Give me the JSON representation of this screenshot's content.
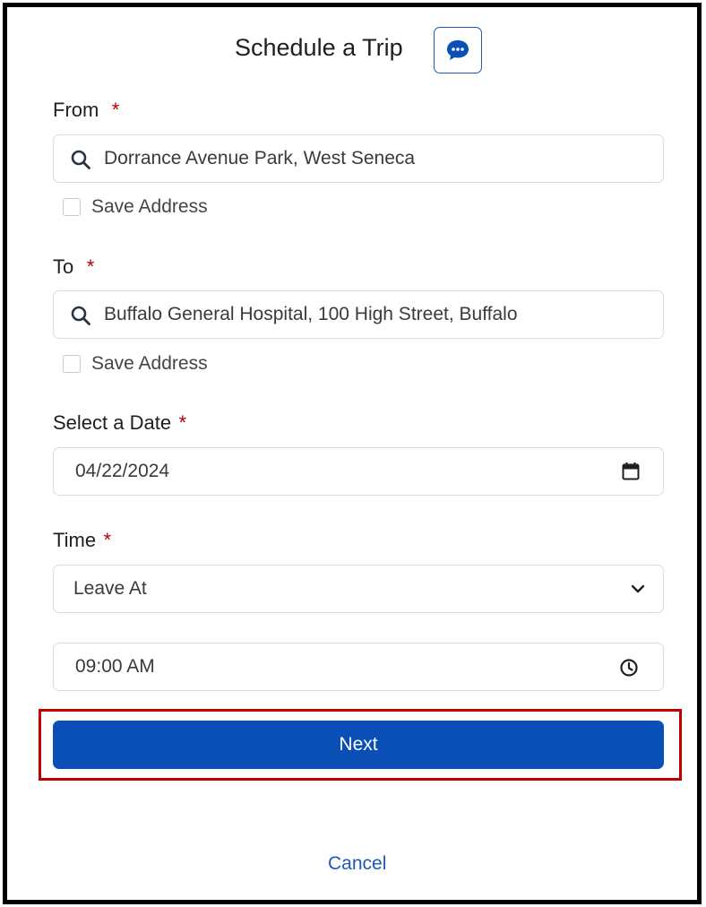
{
  "header": {
    "title": "Schedule a Trip",
    "chat_icon": "chat-bubble-icon"
  },
  "from": {
    "label": "From",
    "required_mark": "*",
    "value": "Dorrance Avenue Park, West Seneca",
    "save_label": "Save Address",
    "save_checked": false
  },
  "to": {
    "label": "To",
    "required_mark": "*",
    "value": "Buffalo General Hospital, 100 High Street, Buffalo",
    "save_label": "Save Address",
    "save_checked": false
  },
  "date": {
    "label": "Select a Date",
    "required_mark": "*",
    "value": "04/22/2024",
    "icon": "calendar-icon"
  },
  "time": {
    "label": "Time",
    "required_mark": "*",
    "mode_value": "Leave At",
    "value": "09:00 AM",
    "icon": "clock-icon"
  },
  "actions": {
    "next_label": "Next",
    "cancel_label": "Cancel"
  },
  "colors": {
    "primary": "#0a4fb5",
    "required": "#b30000",
    "highlight": "#c00000",
    "link": "#1f58b6"
  }
}
